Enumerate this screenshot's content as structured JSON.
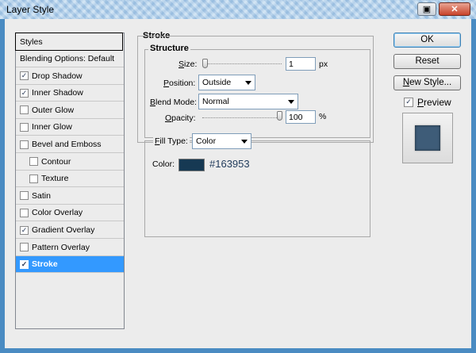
{
  "window": {
    "title": "Layer Style"
  },
  "styles_list": {
    "header": "Styles",
    "items": [
      {
        "label": "Blending Options: Default",
        "checkbox": false,
        "checked": false,
        "indent": false
      },
      {
        "label": "Drop Shadow",
        "checkbox": true,
        "checked": true,
        "indent": false
      },
      {
        "label": "Inner Shadow",
        "checkbox": true,
        "checked": true,
        "indent": false
      },
      {
        "label": "Outer Glow",
        "checkbox": true,
        "checked": false,
        "indent": false
      },
      {
        "label": "Inner Glow",
        "checkbox": true,
        "checked": false,
        "indent": false
      },
      {
        "label": "Bevel and Emboss",
        "checkbox": true,
        "checked": false,
        "indent": false
      },
      {
        "label": "Contour",
        "checkbox": true,
        "checked": false,
        "indent": true
      },
      {
        "label": "Texture",
        "checkbox": true,
        "checked": false,
        "indent": true
      },
      {
        "label": "Satin",
        "checkbox": true,
        "checked": false,
        "indent": false
      },
      {
        "label": "Color Overlay",
        "checkbox": true,
        "checked": false,
        "indent": false
      },
      {
        "label": "Gradient Overlay",
        "checkbox": true,
        "checked": true,
        "indent": false
      },
      {
        "label": "Pattern Overlay",
        "checkbox": true,
        "checked": false,
        "indent": false
      },
      {
        "label": "Stroke",
        "checkbox": true,
        "checked": true,
        "indent": false,
        "selected": true
      }
    ]
  },
  "stroke": {
    "title": "Stroke",
    "structure_title": "Structure",
    "size": {
      "label_prefix": "S",
      "label_rest": "ize:",
      "value": "1",
      "unit": "px",
      "slider_fraction": 0.0
    },
    "position": {
      "label_prefix": "P",
      "label_rest": "osition:",
      "value": "Outside"
    },
    "blend_mode": {
      "label_prefix": "B",
      "label_rest": "lend Mode:",
      "value": "Normal"
    },
    "opacity": {
      "label_prefix": "O",
      "label_rest": "pacity:",
      "value": "100",
      "unit": "%",
      "slider_fraction": 1.0
    },
    "fill_type": {
      "label_prefix": "F",
      "label_rest": "ill Type:",
      "value": "Color"
    },
    "color": {
      "label": "Color:",
      "hex_text": "#163953",
      "swatch_color": "#163953"
    }
  },
  "buttons": {
    "ok": "OK",
    "reset": "Reset",
    "new_style_prefix": "N",
    "new_style_rest": "ew Style..."
  },
  "preview": {
    "label_prefix": "P",
    "label_rest": "review",
    "checked": true,
    "swatch_color": "#3e5c78"
  },
  "titlebar_icons": {
    "restore": "restore-icon",
    "close": "close-icon"
  }
}
